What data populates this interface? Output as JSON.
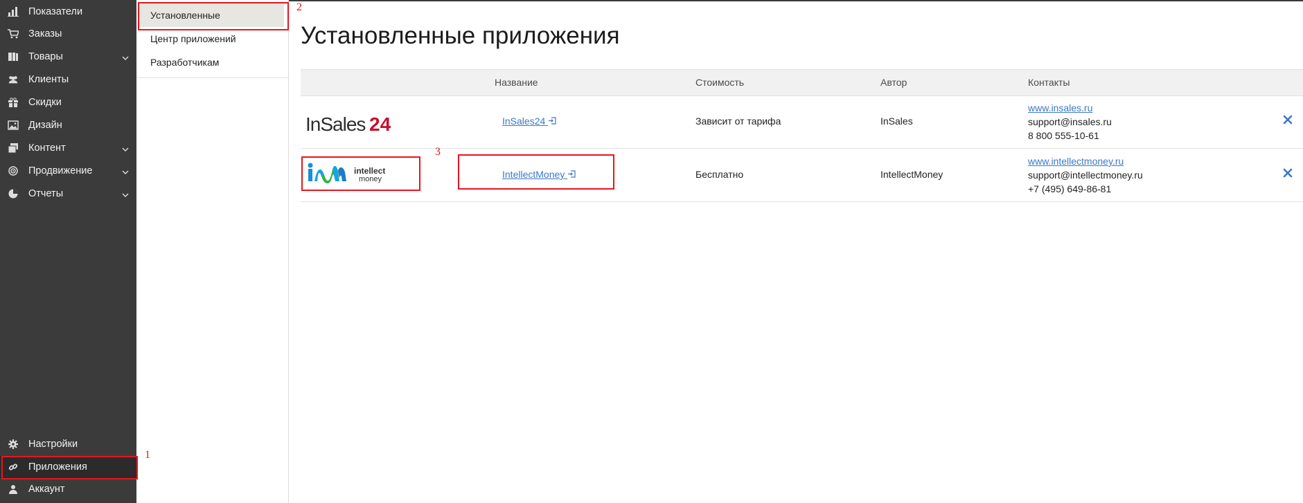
{
  "sidebar": {
    "items": [
      {
        "label": "Показатели",
        "icon": "bar-chart-icon",
        "chevron": false
      },
      {
        "label": "Заказы",
        "icon": "cart-icon",
        "chevron": false
      },
      {
        "label": "Товары",
        "icon": "book-icon",
        "chevron": true
      },
      {
        "label": "Клиенты",
        "icon": "users-icon",
        "chevron": false
      },
      {
        "label": "Скидки",
        "icon": "gift-icon",
        "chevron": false
      },
      {
        "label": "Дизайн",
        "icon": "image-icon",
        "chevron": false
      },
      {
        "label": "Контент",
        "icon": "layers-icon",
        "chevron": true
      },
      {
        "label": "Продвижение",
        "icon": "target-icon",
        "chevron": true
      },
      {
        "label": "Отчеты",
        "icon": "pie-chart-icon",
        "chevron": true
      }
    ],
    "bottom_items": [
      {
        "label": "Настройки",
        "icon": "gear-icon"
      },
      {
        "label": "Приложения",
        "icon": "link-icon",
        "active": true
      },
      {
        "label": "Аккаунт",
        "icon": "user-icon"
      }
    ]
  },
  "submenu": {
    "items": [
      {
        "label": "Установленные",
        "active": true
      },
      {
        "label": "Центр приложений"
      },
      {
        "label": "Разработчикам"
      }
    ]
  },
  "page": {
    "title": "Установленные приложения"
  },
  "table": {
    "headers": [
      "Название",
      "Стоимость",
      "Автор",
      "Контакты"
    ],
    "rows": [
      {
        "logo": "InSales24",
        "name": "InSales24",
        "cost": "Зависит от тарифа",
        "author": "InSales",
        "site": "www.insales.ru",
        "email": "support@insales.ru",
        "phone": "8 800 555-10-61"
      },
      {
        "logo": "intellect money",
        "name": "IntellectMoney",
        "cost": "Бесплатно",
        "author": "IntellectMoney",
        "site": "www.intellectmoney.ru",
        "email": "support@intellectmoney.ru",
        "phone": "+7 (495) 649-86-81"
      }
    ]
  },
  "annotations": [
    "1",
    "2",
    "3"
  ],
  "colors": {
    "sidebar_bg": "#3b3b3c",
    "link": "#3a78c8",
    "annotation": "#e8151b",
    "insales_accent": "#c8102e"
  }
}
